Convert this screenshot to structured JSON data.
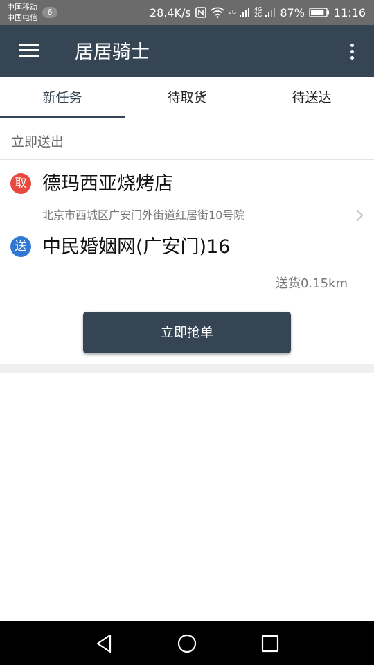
{
  "status_bar": {
    "carrier_1": "中国移动",
    "carrier_2": "中国电信",
    "carrier_badge": "6",
    "net_speed": "28.4K/s",
    "signal_1_label_top": "2G",
    "signal_2_label_top": "4G",
    "signal_2_label_bottom": "2G",
    "battery_percent": "87%",
    "battery_level": 0.87,
    "time": "11:16",
    "icons": [
      "nfc-icon",
      "wifi-icon",
      "signal-icon",
      "signal-icon",
      "battery-icon"
    ]
  },
  "app_bar": {
    "title": "居居骑士",
    "menu_icon": "hamburger-menu-icon",
    "more_icon": "more-vertical-icon"
  },
  "tabs": [
    {
      "label": "新任务",
      "active": true
    },
    {
      "label": "待取货",
      "active": false
    },
    {
      "label": "待送达",
      "active": false
    }
  ],
  "section": {
    "title": "立即送出"
  },
  "task": {
    "pickup_badge": "取",
    "pickup_name": "德玛西亚烧烤店",
    "pickup_address": "北京市西城区广安门外街道红居街10号院",
    "deliver_badge": "送",
    "deliver_name": "中民婚姻网(广安门)16",
    "distance": "送货0.15km",
    "chevron_icon": "chevron-right-icon"
  },
  "grab_button": {
    "label": "立即抢单"
  },
  "nav_bar": {
    "icons": [
      "back-icon",
      "home-icon",
      "recents-icon"
    ]
  },
  "colors": {
    "primary": "#364554",
    "pickup_red": "#e84a3f",
    "deliver_blue": "#2f79d4",
    "status_bar": "#6b6b6b"
  }
}
